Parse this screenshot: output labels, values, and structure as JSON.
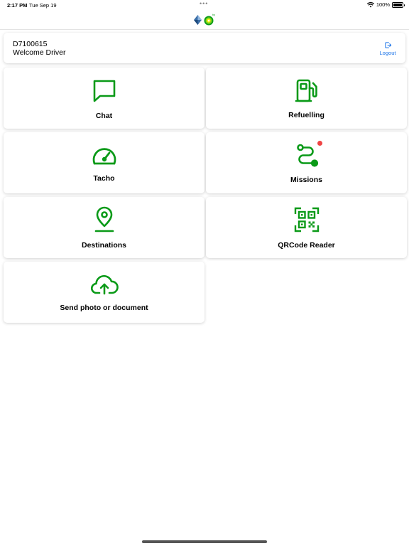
{
  "status_bar": {
    "time": "2:17 PM",
    "date": "Tue Sep 19",
    "battery": "100%",
    "battery_level": 1.0
  },
  "header": {
    "multitask_dots": "•••"
  },
  "driver": {
    "id": "D7100615",
    "welcome": "Welcome Driver",
    "logout_label": "Logout"
  },
  "tiles": [
    {
      "label": "Chat",
      "icon": "chat-icon"
    },
    {
      "label": "Refuelling",
      "icon": "fuel-pump-icon"
    },
    {
      "label": "Tacho",
      "icon": "speedometer-icon"
    },
    {
      "label": "Missions",
      "icon": "route-icon",
      "has_notification": true
    },
    {
      "label": "Destinations",
      "icon": "map-pin-icon"
    },
    {
      "label": "QRCode Reader",
      "icon": "qr-code-icon"
    },
    {
      "label": "Send photo or document",
      "icon": "cloud-upload-icon"
    }
  ],
  "colors": {
    "accent": "#0a9a18",
    "link": "#1a73e8",
    "notification": "#ef4444"
  }
}
